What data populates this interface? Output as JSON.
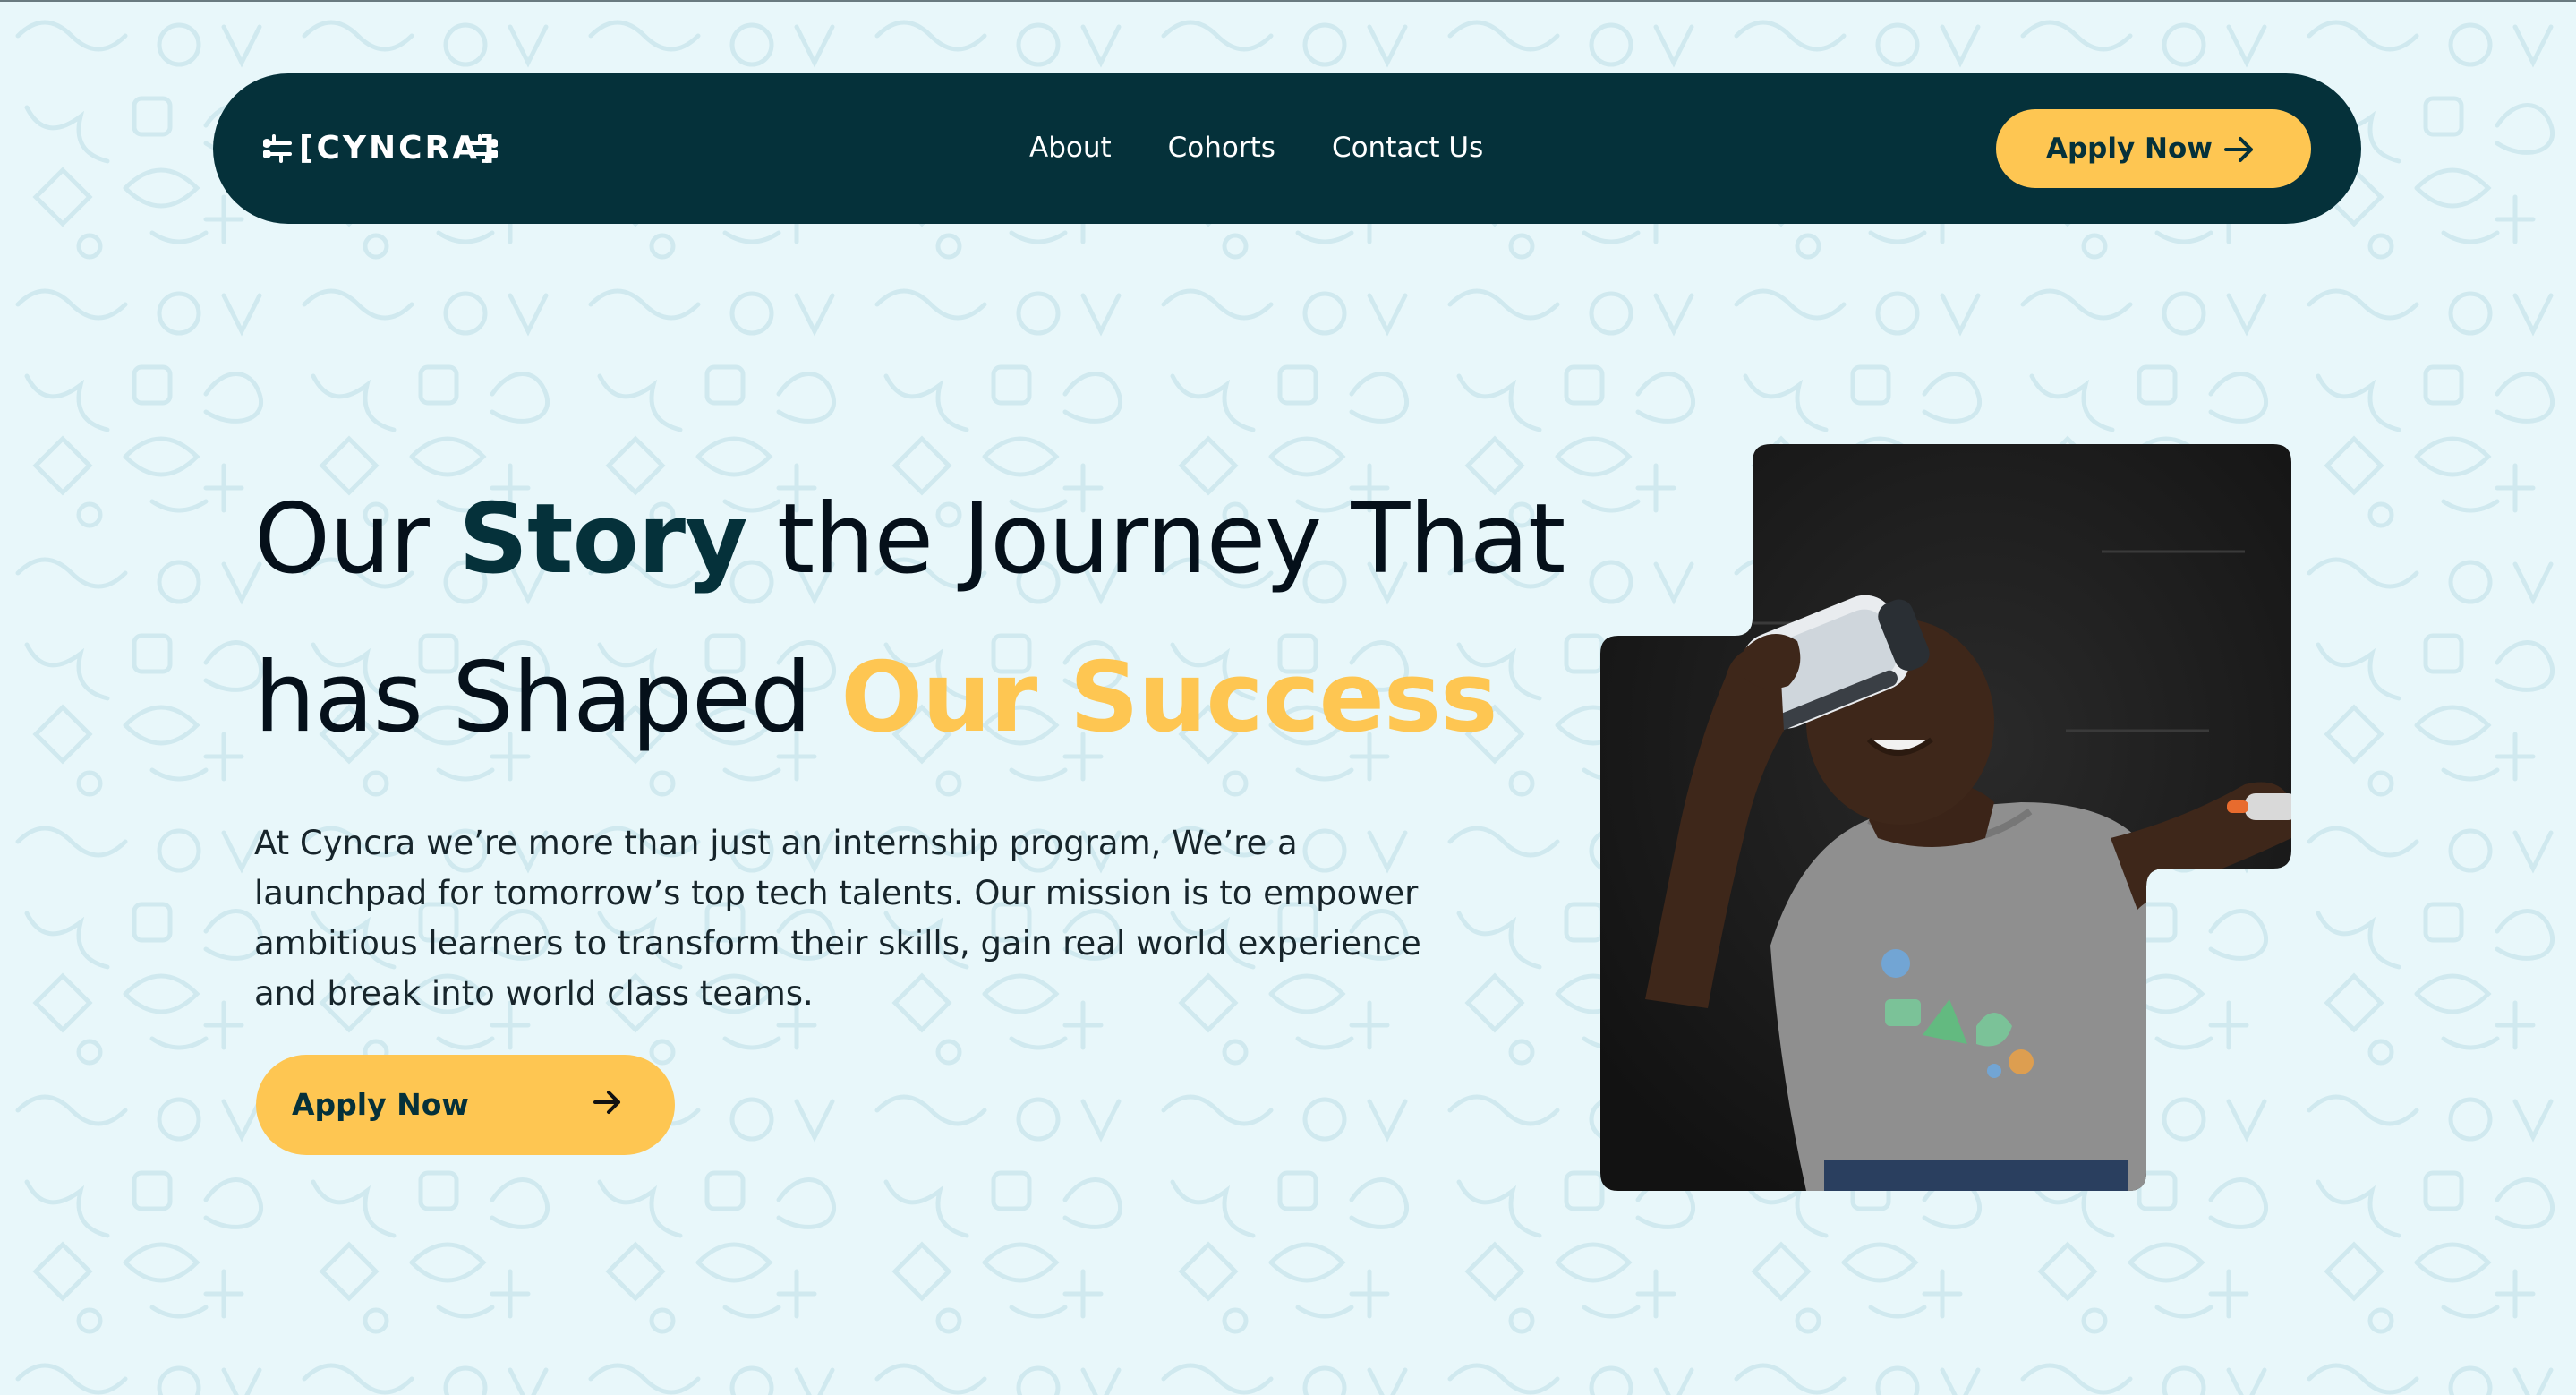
{
  "brand": {
    "logo_text": "[CYNCRA]"
  },
  "nav": {
    "links": [
      "About",
      "Cohorts",
      "Contact Us"
    ],
    "cta_label": "Apply Now"
  },
  "hero": {
    "title_part1": "Our ",
    "title_highlight1": "Story",
    "title_part2": " the Journey That",
    "title_part3": "has Shaped ",
    "title_highlight2": "Our Success",
    "description": "At Cyncra we’re more than just an internship program, We’re a launchpad for tomorrow’s top tech talents. Our mission is to empower ambitious learners to transform their skills, gain real world experience and break into world class teams.",
    "cta_label": "Apply Now"
  },
  "colors": {
    "background": "#e8f7fa",
    "nav_background": "#05313a",
    "accent_gold": "#fec652",
    "accent_dark": "#05313a",
    "text_dark": "#05101a"
  },
  "icons": {
    "nav_cta_icon": "arrow-right-icon",
    "hero_cta_icon": "arrow-right-icon"
  }
}
